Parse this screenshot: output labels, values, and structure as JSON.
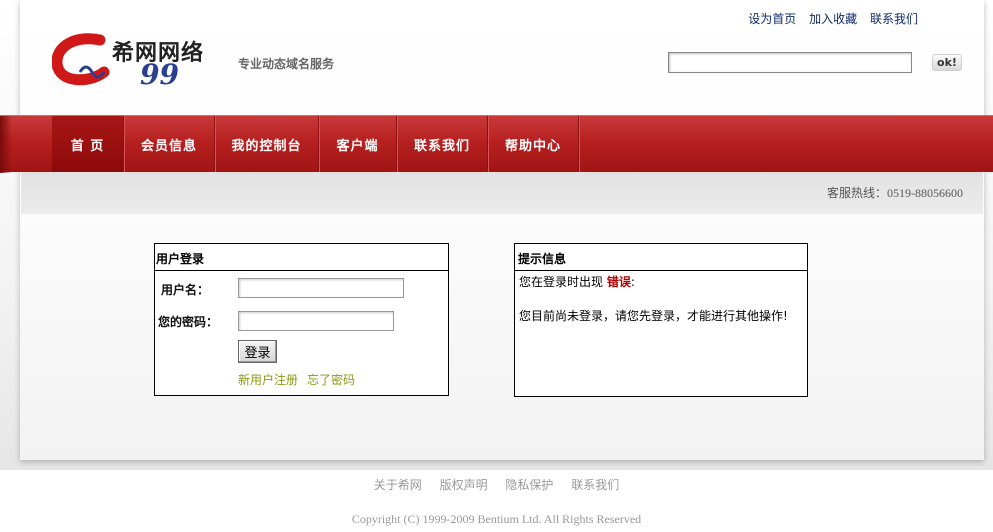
{
  "header": {
    "logo_text": "希网网络",
    "tagline": "专业动态域名服务",
    "top_links": [
      "设为首页",
      "加入收藏",
      "联系我们"
    ],
    "search": {
      "value": "",
      "placeholder": ""
    },
    "ok_label": "ok!"
  },
  "nav": {
    "items": [
      "首 页",
      "会员信息",
      "我的控制台",
      "客户端",
      "联系我们",
      "帮助中心"
    ],
    "active": 0
  },
  "hotline": "客服热线：0519-88056600",
  "login": {
    "title": "用户登录",
    "username_label": "用户名：",
    "password_label": "您的密码：",
    "username_value": "",
    "password_value": "",
    "submit_label": "登录",
    "register_link": "新用户注册",
    "forgot_link": "忘了密码"
  },
  "tip": {
    "title": "提示信息",
    "line1_prefix": "您在登录时出现",
    "line1_error": "错误",
    "line1_suffix": ":",
    "line2": "您目前尚未登录，请您先登录，才能进行其他操作!"
  },
  "footer": {
    "links": [
      "关于希网",
      "版权声明",
      "隐私保护",
      "联系我们"
    ],
    "copyright": "Copyright (C) 1999-2009 Bentium Ltd. All Rights Reserved"
  },
  "colors": {
    "nav_red": "#b72020",
    "link_blue": "#102a6b",
    "link_olive": "#8a9a14",
    "error_red": "#b00000"
  }
}
